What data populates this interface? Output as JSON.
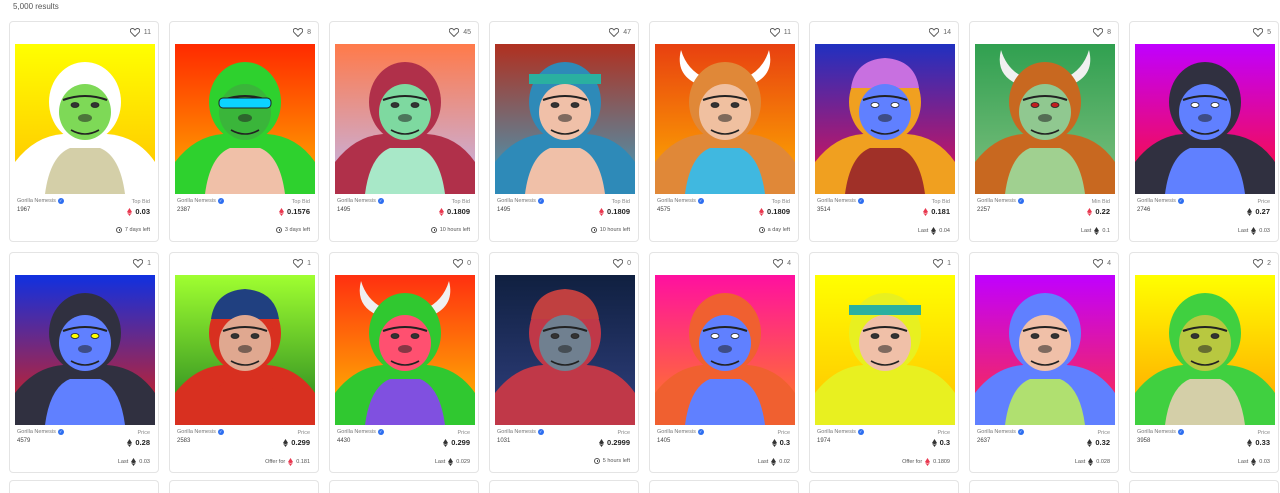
{
  "results_count": "5,000 results",
  "colors": {
    "accent": "#2d6ef0",
    "eth_red": "#e8384f",
    "eth_dark": "#333333"
  },
  "cards": [
    {
      "likes": "11",
      "collection": "Gorilla Nemesis",
      "token": "1967",
      "price_label": "Top Bid",
      "price": "0.03",
      "currency": "weth",
      "footer": "7 days left",
      "footer_type": "time",
      "bg": [
        "#ffff00",
        "#ffc000"
      ],
      "fur": "#ffffff",
      "face": "#7ed957",
      "shirt": "#d4cfa8",
      "horns": false,
      "cap": null,
      "eyes": "#333",
      "headband": false
    },
    {
      "likes": "8",
      "collection": "Gorilla Nemesis",
      "token": "2387",
      "price_label": "Top Bid",
      "price": "0.1576",
      "currency": "weth",
      "footer": "3 days left",
      "footer_type": "time",
      "bg": [
        "#ff2a00",
        "#ffb000"
      ],
      "fur": "#2ed12e",
      "face": "#3ab53a",
      "shirt": "#f0c0a8",
      "horns": false,
      "cap": null,
      "eyes": "#0bd3ff",
      "headband": false,
      "visor": true
    },
    {
      "likes": "45",
      "collection": "Gorilla Nemesis",
      "token": "1495",
      "price_label": "Top Bid",
      "price": "0.1809",
      "currency": "weth",
      "footer": "10 hours left",
      "footer_type": "time",
      "bg": [
        "#ff7a4a",
        "#c0b8f0"
      ],
      "fur": "#b0304a",
      "face": "#7ed9a0",
      "shirt": "#a8e8c8",
      "horns": false,
      "cap": null,
      "eyes": "#333",
      "headband": false
    },
    {
      "likes": "47",
      "collection": "Gorilla Nemesis",
      "token": "1495",
      "price_label": "Top Bid",
      "price": "0.1809",
      "currency": "weth",
      "footer": "10 hours left",
      "footer_type": "time",
      "bg": [
        "#b03020",
        "#40a0c0"
      ],
      "fur": "#2e8ab8",
      "face": "#f0c0a8",
      "shirt": "#f0c0a8",
      "horns": false,
      "cap": null,
      "eyes": "#333",
      "headband": true,
      "headband_color": "#2ab0a0"
    },
    {
      "likes": "11",
      "collection": "Gorilla Nemesis",
      "token": "4575",
      "price_label": "Top Bid",
      "price": "0.1809",
      "currency": "weth",
      "footer": "a day left",
      "footer_type": "time",
      "bg": [
        "#e84010",
        "#ffb000"
      ],
      "fur": "#e08838",
      "face": "#f0c0a0",
      "shirt": "#40b8e0",
      "horns": true,
      "horn_color": "#ffffff",
      "cap": null,
      "eyes": "#333",
      "headband": false
    },
    {
      "likes": "14",
      "collection": "Gorilla Nemesis",
      "token": "3514",
      "price_label": "Top Bid",
      "price": "0.181",
      "currency": "weth",
      "footer": "Last",
      "footer_value": "0.04",
      "footer_type": "last",
      "bg": [
        "#2030c0",
        "#e81050"
      ],
      "fur": "#f0a020",
      "face": "#6080ff",
      "shirt": "#a03028",
      "horns": false,
      "cap": "#c870e0",
      "eyes": "#fff",
      "headband": false
    },
    {
      "likes": "8",
      "collection": "Gorilla Nemesis",
      "token": "2257",
      "price_label": "Min Bid",
      "price": "0.22",
      "currency": "weth",
      "footer": "Last",
      "footer_value": "0.1",
      "footer_type": "last",
      "bg": [
        "#30a050",
        "#80c080"
      ],
      "fur": "#c86820",
      "face": "#90c890",
      "shirt": "#a0d090",
      "horns": true,
      "horn_color": "#f0f0f0",
      "cap": null,
      "eyes": "#c02020",
      "headband": false
    },
    {
      "likes": "5",
      "collection": "Gorilla Nemesis",
      "token": "2746",
      "price_label": "Price",
      "price": "0.27",
      "currency": "eth",
      "footer": "Last",
      "footer_value": "0.03",
      "footer_type": "last",
      "bg": [
        "#c000ff",
        "#ff1030"
      ],
      "fur": "#303040",
      "face": "#6080ff",
      "shirt": "#6080ff",
      "horns": false,
      "cap": null,
      "eyes": "#ffffff",
      "headband": false
    },
    {
      "likes": "1",
      "collection": "Gorilla Nemesis",
      "token": "4579",
      "price_label": "Price",
      "price": "0.28",
      "currency": "eth",
      "footer": "Last",
      "footer_value": "0.03",
      "footer_type": "last",
      "bg": [
        "#1030e0",
        "#e02010"
      ],
      "fur": "#303040",
      "face": "#6080ff",
      "shirt": "#6080ff",
      "horns": false,
      "cap": null,
      "eyes": "#ffff00",
      "headband": false
    },
    {
      "likes": "1",
      "collection": "Gorilla Nemesis",
      "token": "2583",
      "price_label": "Price",
      "price": "0.299",
      "currency": "eth",
      "footer": "Offer for",
      "footer_value": "0.181",
      "footer_type": "offer",
      "bg": [
        "#a0ff30",
        "#208020"
      ],
      "fur": "#d83020",
      "face": "#e0a890",
      "shirt": "#d83020",
      "horns": false,
      "cap": "#204080",
      "eyes": "#333",
      "headband": false
    },
    {
      "likes": "0",
      "collection": "Gorilla Nemesis",
      "token": "4430",
      "price_label": "Price",
      "price": "0.299",
      "currency": "eth",
      "footer": "Last",
      "footer_value": "0.029",
      "footer_type": "last",
      "bg": [
        "#ff3010",
        "#ffc000"
      ],
      "fur": "#30c830",
      "face": "#ff5070",
      "shirt": "#8050e0",
      "horns": true,
      "horn_color": "#f0f0f0",
      "cap": null,
      "eyes": "#333",
      "headband": false
    },
    {
      "likes": "0",
      "collection": "Gorilla Nemesis",
      "token": "1031",
      "price_label": "Price",
      "price": "0.2999",
      "currency": "eth",
      "footer": "5 hours left",
      "footer_type": "time",
      "bg": [
        "#102040",
        "#304080"
      ],
      "fur": "#c03848",
      "face": "#708090",
      "shirt": "#c03848",
      "horns": false,
      "cap": "#c04040",
      "eyes": "#333",
      "headband": false
    },
    {
      "likes": "4",
      "collection": "Gorilla Nemesis",
      "token": "1405",
      "price_label": "Price",
      "price": "0.3",
      "currency": "eth",
      "footer": "Last",
      "footer_value": "0.02",
      "footer_type": "last",
      "bg": [
        "#ff10a0",
        "#ff8020"
      ],
      "fur": "#f06030",
      "face": "#6080ff",
      "shirt": "#6080ff",
      "horns": false,
      "cap": null,
      "eyes": "#fff",
      "headband": false
    },
    {
      "likes": "1",
      "collection": "Gorilla Nemesis",
      "token": "1974",
      "price_label": "Price",
      "price": "0.3",
      "currency": "eth",
      "footer": "Offer for",
      "footer_value": "0.1809",
      "footer_type": "offer",
      "bg": [
        "#ffff00",
        "#ffc000"
      ],
      "fur": "#e8f020",
      "face": "#f0c0a8",
      "shirt": "#e8f020",
      "horns": false,
      "cap": null,
      "eyes": "#333",
      "headband": true,
      "headband_color": "#2ab0a0"
    },
    {
      "likes": "4",
      "collection": "Gorilla Nemesis",
      "token": "2637",
      "price_label": "Price",
      "price": "0.32",
      "currency": "eth",
      "footer": "Last",
      "footer_value": "0.028",
      "footer_type": "last",
      "bg": [
        "#c000ff",
        "#ff3040"
      ],
      "fur": "#6080ff",
      "face": "#f0c0a8",
      "shirt": "#b0e070",
      "horns": false,
      "cap": null,
      "eyes": "#333",
      "headband": false
    },
    {
      "likes": "2",
      "collection": "Gorilla Nemesis",
      "token": "3958",
      "price_label": "Price",
      "price": "0.33",
      "currency": "eth",
      "footer": "Last",
      "footer_value": "0.03",
      "footer_type": "last",
      "bg": [
        "#ffff00",
        "#ffa000"
      ],
      "fur": "#40d040",
      "face": "#b8c840",
      "shirt": "#d4cfa8",
      "horns": false,
      "cap": null,
      "eyes": "#333",
      "headband": false
    }
  ]
}
